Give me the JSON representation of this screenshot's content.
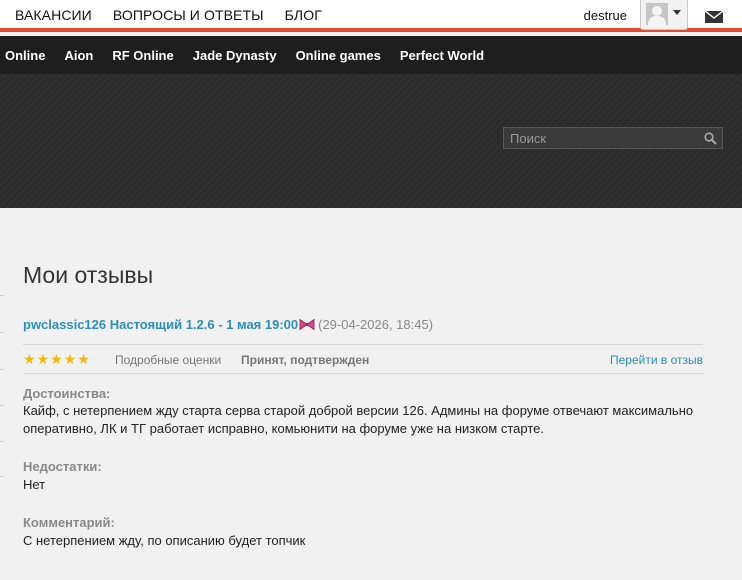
{
  "topnav": {
    "items": [
      "ВАКАНСИИ",
      "ВОПРОСЫ И ОТВЕТЫ",
      "БЛОГ"
    ]
  },
  "user": {
    "name": "destrue"
  },
  "gamenav": {
    "items": [
      "Online",
      "Aion",
      "RF Online",
      "Jade Dynasty",
      "Online games",
      "Perfect World"
    ]
  },
  "search": {
    "placeholder": "Поиск"
  },
  "page": {
    "title": "Мои отзывы"
  },
  "review": {
    "title": "pwclassic126 Настоящий 1.2.6 - 1 мая 19:00",
    "date": "(29-04-2026, 18:45)",
    "rating_stars": 5,
    "rating_max": 5,
    "detailed_label": "Подробные оценки",
    "status": "Принят, подтвержден",
    "goto_label": "Перейти в отзыв",
    "pros_label": "Достоинства:",
    "pros_text": "Кайф, с нетерпением жду старта серва старой доброй версии 126. Админы на форуме отвечают максимально оперативно, ЛК и ТГ работает исправно, комьюнити на форуме уже на низком старте.",
    "cons_label": "Недостатки:",
    "cons_text": "Нет",
    "comment_label": "Комментарий:",
    "comment_text": "С нетерпением жду, по описанию будет топчик"
  },
  "colors": {
    "accent": "#e24b2d",
    "link": "#2a8fbe",
    "star": "#f5b800",
    "hero_bg": "#2b2b2b"
  }
}
